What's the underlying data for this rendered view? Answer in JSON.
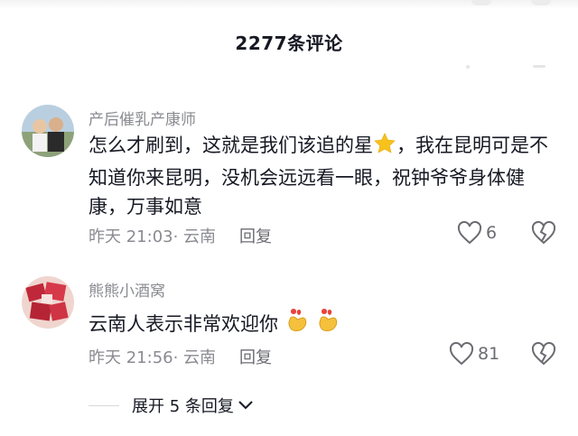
{
  "header": {
    "title": "2277条评论"
  },
  "comments": [
    {
      "username": "产后催乳产康师",
      "content": "怎么才刷到，这就是我们该追的星",
      "content_tail": "，我在昆明可是不知道你来昆明，没机会远远看一眼，祝钟爷爷身体健康，万事如意",
      "time_location": "昨天 21:03· 云南",
      "reply_label": "回复",
      "like_count": "6"
    },
    {
      "username": "熊熊小酒窝",
      "content": "云南人表示非常欢迎你",
      "time_location": "昨天 21:56· 云南",
      "reply_label": "回复",
      "like_count": "81"
    }
  ],
  "expand": {
    "label": "展开 5 条回复"
  },
  "icons": {
    "star": "star-emoji",
    "heart": "heart-outline-icon",
    "dislike": "broken-heart-icon",
    "hands": "finger-heart-emoji",
    "chevron": "chevron-down-icon"
  },
  "colors": {
    "text": "#161823",
    "muted": "#8a8b91",
    "star": "#f7c21b",
    "hands": "#f5c13c"
  }
}
